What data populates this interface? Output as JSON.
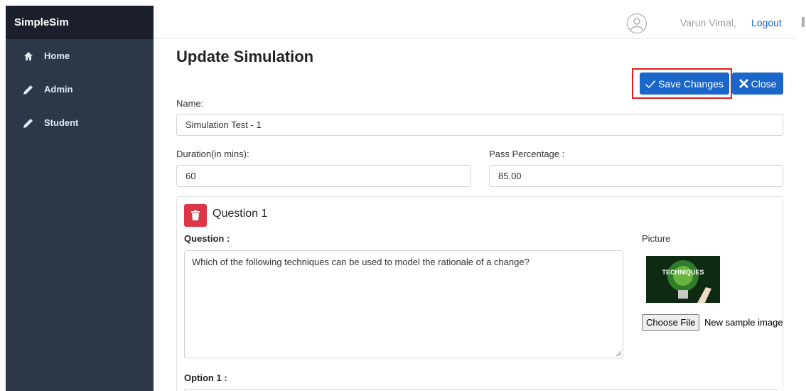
{
  "sidebar": {
    "brand": "SimpleSim",
    "items": [
      {
        "label": "Home",
        "icon": "home-icon"
      },
      {
        "label": "Admin",
        "icon": "pencil-icon"
      },
      {
        "label": "Student",
        "icon": "pencil-icon"
      }
    ]
  },
  "header": {
    "user_name": "Varun Vimal,",
    "logout_label": "Logout",
    "avatar_icon": "user-icon"
  },
  "main": {
    "title": "Update Simulation",
    "save_label": "Save Changes",
    "close_label": "Close",
    "name_label": "Name:",
    "name_value": "Simulation Test - 1",
    "duration_label": "Duration(in mins):",
    "duration_value": "60",
    "pass_label": "Pass Percentage :",
    "pass_value": "85.00"
  },
  "question": {
    "title": "Question 1",
    "question_label": "Question :",
    "question_text": "Which of the following techniques can be used to model the rationale of a change?",
    "picture_label": "Picture",
    "picture_text": "TECHNIQUES",
    "choose_file_label": "Choose File",
    "file_name": "New sample image",
    "option_label": "Option 1 :"
  },
  "colors": {
    "sidebar_bg": "#2d3748",
    "brand_bg": "#1b1f2b",
    "primary": "#1a66c9",
    "danger": "#dc3545",
    "highlight": "#e11d1d"
  }
}
